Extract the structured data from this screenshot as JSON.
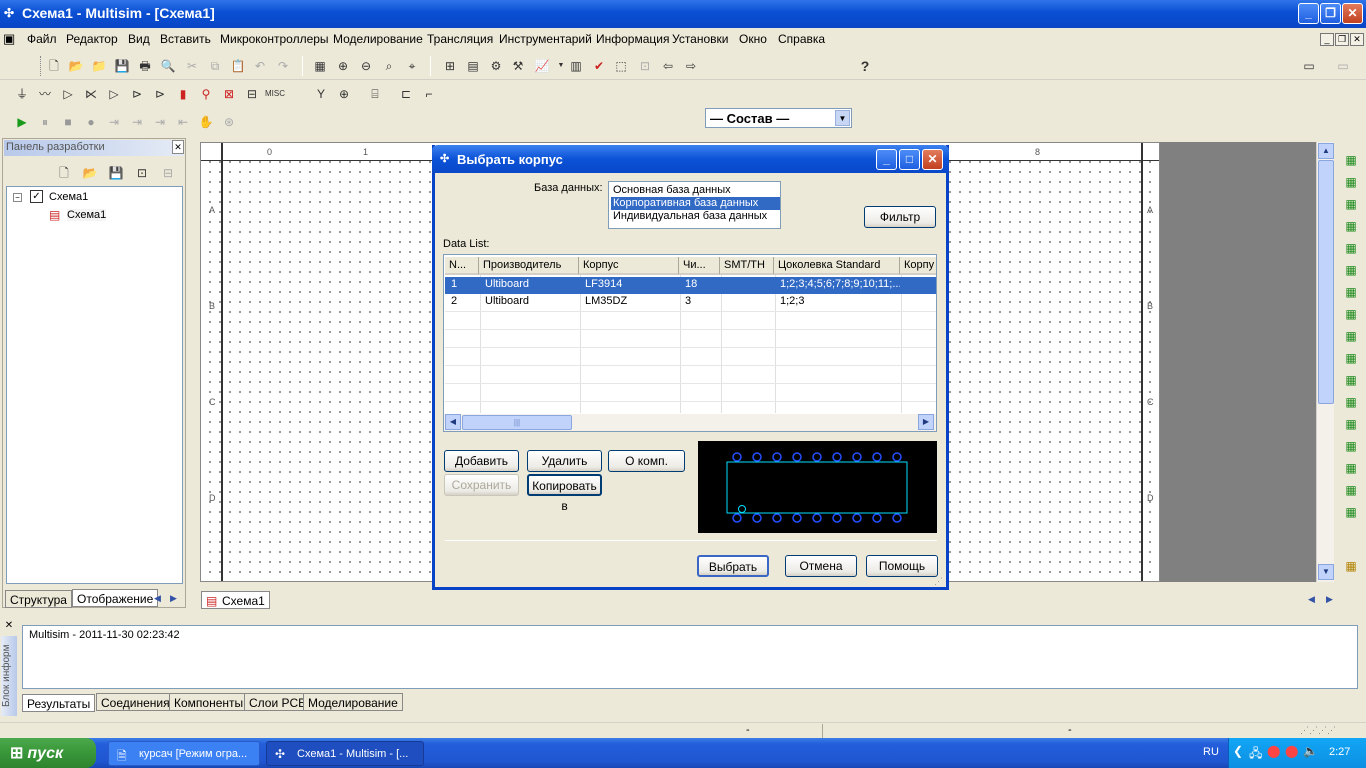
{
  "window": {
    "title": "Схема1 - Multisim - [Схема1]"
  },
  "menu": {
    "items": [
      "Файл",
      "Редактор",
      "Вид",
      "Вставить",
      "Микроконтроллеры",
      "Моделирование",
      "Трансляция",
      "Инструментарий",
      "Информация",
      "Установки",
      "Окно",
      "Справка"
    ]
  },
  "toolbar": {
    "combo_value": "— Состав —",
    "help_glyph": "?"
  },
  "design_toolbox": {
    "title": "Панель разработки",
    "tree_root": "Схема1",
    "tree_child": "Схема1",
    "tabs": [
      "Структура",
      "Отображение"
    ]
  },
  "canvas": {
    "ruler_top": [
      "0",
      "1",
      "8"
    ],
    "ruler_side": [
      "A",
      "B",
      "C",
      "D"
    ],
    "doc_tab": "Схема1"
  },
  "dialog": {
    "title": "Выбрать корпус",
    "db_label": "База данных:",
    "databases": [
      "Основная база данных",
      "Корпоративная база данных",
      "Индивидуальная база данных"
    ],
    "selected_db_index": 1,
    "filter_button": "Фильтр",
    "data_list_label": "Data List:",
    "columns": [
      "N...",
      "Производитель",
      "Корпус",
      "Чи...",
      "SMT/TH",
      "Цоколевка Standard",
      "Корпу"
    ],
    "rows": [
      {
        "n": "1",
        "vendor": "Ultiboard",
        "package": "LF3914",
        "pins": "18",
        "smt": "",
        "pinout": "1;2;3;4;5;6;7;8;9;10;11;...",
        "extra": ""
      },
      {
        "n": "2",
        "vendor": "Ultiboard",
        "package": "LM35DZ",
        "pins": "3",
        "smt": "",
        "pinout": "1;2;3",
        "extra": ""
      }
    ],
    "selected_row_index": 0,
    "buttons": {
      "add": "Добавить",
      "delete": "Удалить",
      "about": "О комп.",
      "save": "Сохранить",
      "copy": "Копировать в",
      "select": "Выбрать",
      "cancel": "Отмена",
      "help": "Помощь"
    }
  },
  "spreadsheet": {
    "side_label": "Блок информ",
    "output_text": "Multisim  -  2011-11-30 02:23:42",
    "tabs": [
      "Результаты",
      "Соединения",
      "Компоненты",
      "Слои PCB",
      "Моделирование"
    ]
  },
  "statusbar": {
    "cells": [
      "-",
      "-",
      "-"
    ]
  },
  "taskbar": {
    "start": "пуск",
    "tasks": [
      "курсач [Режим огра...",
      "Схема1 - Multisim - [..."
    ],
    "lang": "RU",
    "clock": "2:27"
  },
  "colors": {
    "accent": "#316ac5",
    "titlebar": "#0a4fd4",
    "taskbar": "#245edb",
    "start": "#3c9a3c"
  }
}
